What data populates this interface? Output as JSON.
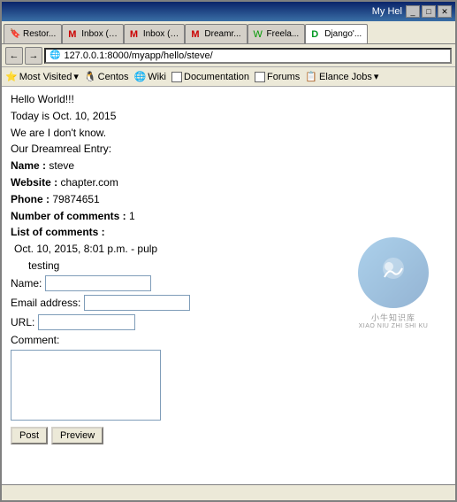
{
  "titlebar": {
    "title": "My Hel"
  },
  "tabs": [
    {
      "label": "Restor...",
      "icon": "🔖",
      "active": false
    },
    {
      "label": "Inbox (…",
      "icon": "M",
      "active": false
    },
    {
      "label": "Inbox (…",
      "icon": "M",
      "active": false
    },
    {
      "label": "Dreamr...",
      "icon": "M",
      "active": false
    },
    {
      "label": "Freela...",
      "icon": "G",
      "active": false
    },
    {
      "label": "Django'...",
      "icon": "D",
      "active": true
    }
  ],
  "navbar": {
    "back_label": "←",
    "forward_label": "→",
    "address": "127.0.0.1:8000/myapp/hello/steve/"
  },
  "bookmarks": [
    {
      "label": "Most Visited",
      "has_arrow": true,
      "icon": "⭐"
    },
    {
      "label": "Centos",
      "icon": "🐧"
    },
    {
      "label": "Wiki",
      "icon": "🌐"
    },
    {
      "label": "Documentation",
      "has_checkbox": true
    },
    {
      "label": "Forums",
      "has_checkbox": true
    },
    {
      "label": "Elance Jobs",
      "has_arrow": true,
      "icon": "📋"
    }
  ],
  "content": {
    "line1": "Hello World!!!",
    "line2": "Today is Oct. 10, 2015",
    "line3": "We are I don't know.",
    "line4": "Our Dreamreal Entry:",
    "name_label": "Name :",
    "name_value": "steve",
    "website_label": "Website :",
    "website_value": "chapter.com",
    "phone_label": "Phone :",
    "phone_value": "79874651",
    "num_comments_label": "Number of comments :",
    "num_comments_value": "1",
    "list_comments_label": "List of comments :",
    "comment_date": "Oct. 10, 2015, 8:01 p.m. - pulp",
    "comment_text": "testing",
    "form": {
      "name_label": "Name:",
      "email_label": "Email address:",
      "url_label": "URL:",
      "comment_label": "Comment:",
      "post_btn": "Post",
      "preview_btn": "Preview"
    }
  },
  "watermark": {
    "text1": "小牛知识库",
    "text2": "XIAO NIU ZHI SHI KU"
  },
  "statusbar": {
    "text": ""
  }
}
